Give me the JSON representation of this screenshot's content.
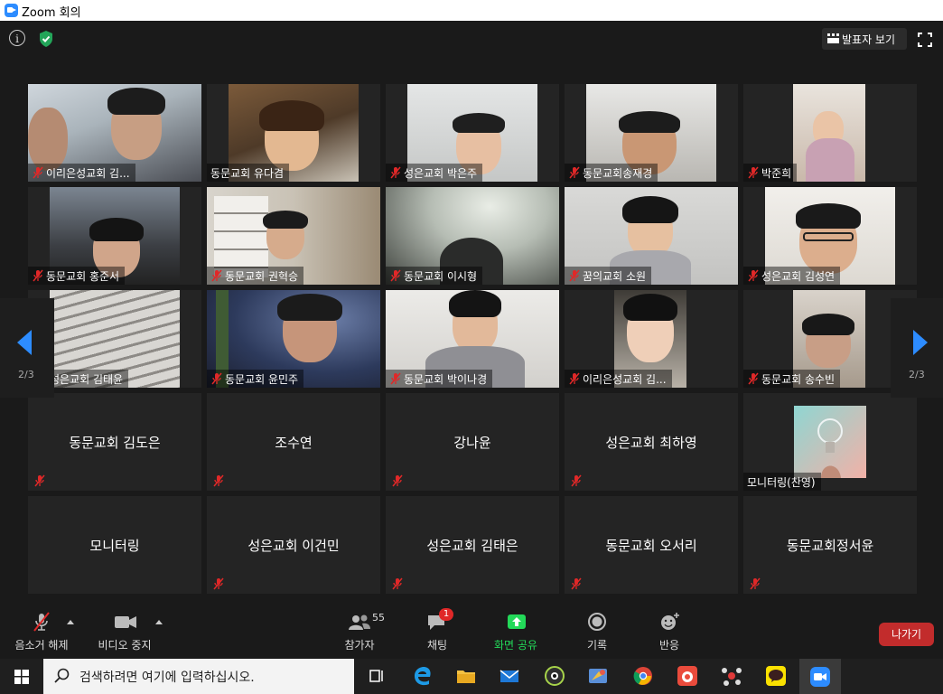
{
  "window": {
    "title": "Zoom 회의"
  },
  "top": {
    "speaker_view_label": "발표자 보기"
  },
  "pagination": {
    "left": "2/3",
    "right": "2/3"
  },
  "tiles": [
    {
      "name": "이리은성교회 김...",
      "video": true,
      "muted": true
    },
    {
      "name": "동문교회 유다겸",
      "video": true,
      "muted": false
    },
    {
      "name": "성은교회 박은주",
      "video": true,
      "muted": true
    },
    {
      "name": "동문교회송재경",
      "video": true,
      "muted": true
    },
    {
      "name": "박준희",
      "video": true,
      "muted": true
    },
    {
      "name": "동문교회 홍준서",
      "video": true,
      "muted": true
    },
    {
      "name": "동문교회 권혁승",
      "video": true,
      "muted": true
    },
    {
      "name": "동문교회 이시형",
      "video": true,
      "muted": true
    },
    {
      "name": "꿈의교회 소원",
      "video": true,
      "muted": true
    },
    {
      "name": "성은교회 김성연",
      "video": true,
      "muted": true
    },
    {
      "name": "성은교회 김태윤",
      "video": true,
      "muted": false
    },
    {
      "name": "동문교회  윤민주",
      "video": true,
      "muted": true
    },
    {
      "name": "동문교회 박이나경",
      "video": true,
      "muted": true
    },
    {
      "name": "이리은성교회 김...",
      "video": true,
      "muted": true
    },
    {
      "name": "동문교회 송수빈",
      "video": true,
      "muted": true
    },
    {
      "name": "동문교회 김도은",
      "video": false,
      "muted": true
    },
    {
      "name": "조수연",
      "video": false,
      "muted": true
    },
    {
      "name": "강나윤",
      "video": false,
      "muted": true
    },
    {
      "name": "성은교회 최하영",
      "video": false,
      "muted": true
    },
    {
      "name": "모니터링(찬영)",
      "video": true,
      "muted": false
    },
    {
      "name": "모니터링",
      "video": false,
      "muted": false
    },
    {
      "name": "성은교회 이건민",
      "video": false,
      "muted": true
    },
    {
      "name": "성은교회 김태은",
      "video": false,
      "muted": true
    },
    {
      "name": "동문교회 오서리",
      "video": false,
      "muted": true
    },
    {
      "name": "동문교회정서윤",
      "video": false,
      "muted": true
    }
  ],
  "toolbar": {
    "unmute": "음소거 해제",
    "stop_video": "비디오 중지",
    "participants": "참가자",
    "participants_count": "55",
    "chat": "채팅",
    "chat_badge": "1",
    "share_screen": "화면 공유",
    "record": "기록",
    "reactions": "반응",
    "leave": "나가기"
  },
  "taskbar": {
    "search_placeholder": "검색하려면 여기에 입력하십시오."
  },
  "colors": {
    "accent": "#2d8cff",
    "share_green": "#23d959",
    "leave_red": "#c22c2c",
    "mute_red": "#e02828"
  }
}
